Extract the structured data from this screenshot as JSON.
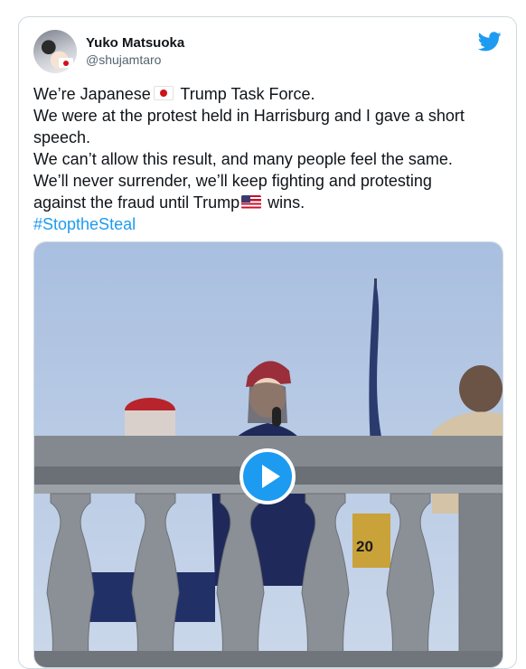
{
  "tweet": {
    "author_name": "Yuko Matsuoka",
    "author_handle": "@shujamtaro",
    "lines": [
      {
        "before": "We’re Japanese",
        "after": " Trump Task Force."
      },
      "We were at the protest held in Harrisburg and I gave a short",
      "speech.",
      "We can’t allow this result, and many people feel the same.",
      "We’ll never surrender, we’ll keep fighting and protesting",
      {
        "before": "against the fraud until Trump",
        "after": " wins."
      }
    ],
    "hashtag": "#StoptheSteal"
  },
  "icons": {
    "brand": "twitter-bird-icon",
    "play": "play-icon",
    "emoji_1": "japan-flag-icon",
    "emoji_2": "us-flag-icon"
  },
  "colors": {
    "accent": "#1d9bf0",
    "text": "#0f1419",
    "muted": "#536471",
    "border": "#cfd9de"
  },
  "media": {
    "type": "video",
    "jersey_number": "20"
  }
}
